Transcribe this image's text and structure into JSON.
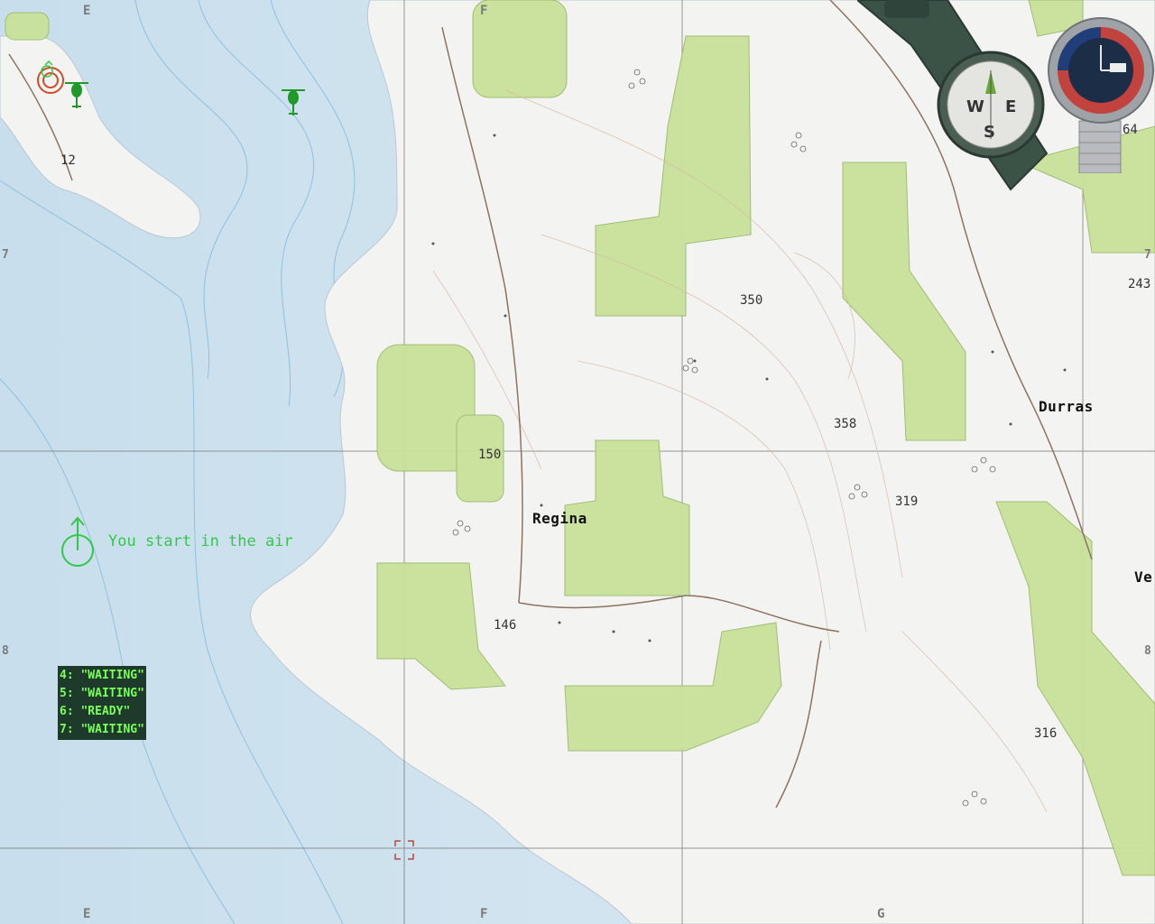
{
  "map": {
    "towns": [
      {
        "name": "Regina"
      },
      {
        "name": "Durras"
      },
      {
        "name": "Ve"
      }
    ],
    "elevations": [
      "12",
      "350",
      "358",
      "150",
      "319",
      "146",
      "316",
      "243",
      "64"
    ],
    "grid_letters_top": [
      "E",
      "F"
    ],
    "grid_letters_bottom": [
      "E",
      "F",
      "G"
    ],
    "grid_numbers_left": [
      "7",
      "8"
    ],
    "grid_numbers_right": [
      "7",
      "8"
    ]
  },
  "hint": {
    "text": "You start in the air",
    "icon": "power-icon",
    "color": "#32c84a"
  },
  "status_list": [
    "4: \"WAITING\"",
    "5: \"WAITING\"",
    "6: \"READY\"",
    "7: \"WAITING\""
  ],
  "tools": {
    "compass": {
      "icon": "compass-icon",
      "labels": {
        "w": "W",
        "e": "E",
        "s": "S"
      }
    },
    "watch": {
      "icon": "watch-icon"
    }
  },
  "markers": {
    "helicopter_1": "helicopter-icon",
    "helicopter_2": "helicopter-icon",
    "target_marker": "target-icon",
    "cursor": "crosshair-icon"
  },
  "colors": {
    "sea": "#cfe3ef",
    "land": "#f4f4f2",
    "forest": "#c9e29a",
    "grid": "#6d6d6d",
    "hint_green": "#32c84a",
    "status_green": "#7cff5a"
  }
}
